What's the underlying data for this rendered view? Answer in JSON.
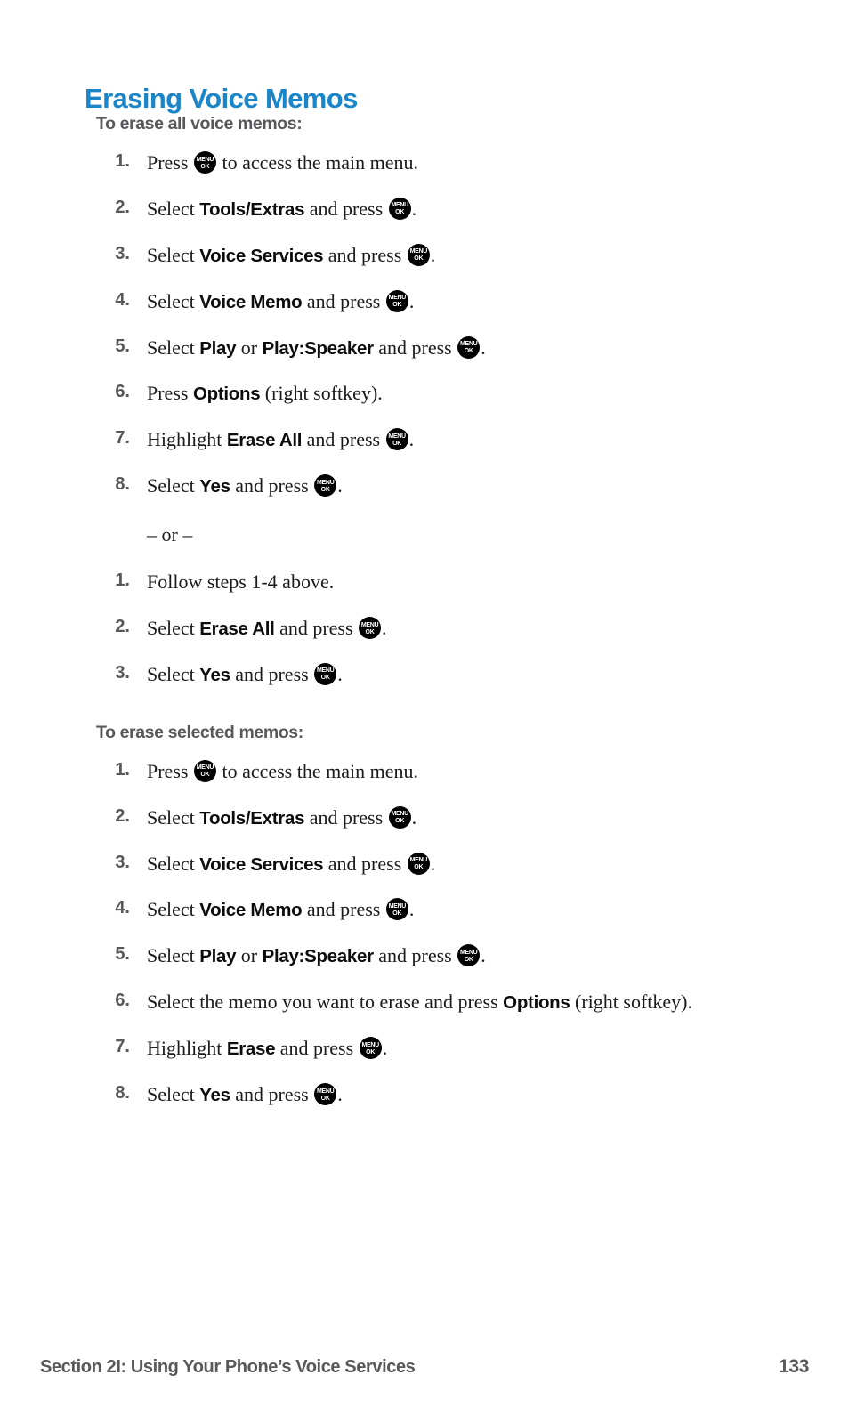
{
  "page": {
    "title": "Erasing Voice Memos",
    "title_color": "#1a86c9",
    "heading_color": "#58585a"
  },
  "menu_key": {
    "line1": "MENU",
    "line2": "OK",
    "name": "menu-ok-key-icon"
  },
  "sections": [
    {
      "heading": "To erase all voice memos:",
      "steps": [
        {
          "num": "1.",
          "pre": "Press ",
          "key": true,
          "post": " to access the main menu."
        },
        {
          "num": "2.",
          "pre": "Select ",
          "bold": "Tools/Extras",
          "mid": " and press ",
          "key": true,
          "post": "."
        },
        {
          "num": "3.",
          "pre": "Select ",
          "bold": "Voice Services",
          "mid": " and press ",
          "key": true,
          "post": "."
        },
        {
          "num": "4.",
          "pre": "Select ",
          "bold": "Voice Memo",
          "mid": " and press ",
          "key": true,
          "post": "."
        },
        {
          "num": "5.",
          "pre": "Select ",
          "bold": "Play",
          "mid2": " or ",
          "bold2": "Play:Speaker",
          "mid": " and press ",
          "key": true,
          "post": "."
        },
        {
          "num": "6.",
          "pre": "Press ",
          "bold": "Options",
          "mid": " (right softkey).",
          "key": false,
          "post": ""
        },
        {
          "num": "7.",
          "pre": "Highlight ",
          "bold": "Erase All",
          "mid": " and press ",
          "key": true,
          "post": "."
        },
        {
          "num": "8.",
          "pre": "Select ",
          "bold": "Yes",
          "mid": " and press ",
          "key": true,
          "post": "."
        }
      ],
      "divider": "– or –",
      "steps_alt": [
        {
          "num": "1.",
          "pre": "Follow steps 1-4 above.",
          "key": false,
          "post": ""
        },
        {
          "num": "2.",
          "pre": "Select ",
          "bold": "Erase All",
          "mid": " and press ",
          "key": true,
          "post": "."
        },
        {
          "num": "3.",
          "pre": "Select ",
          "bold": "Yes",
          "mid": " and press ",
          "key": true,
          "post": "."
        }
      ]
    },
    {
      "heading": "To erase selected memos:",
      "steps": [
        {
          "num": "1.",
          "pre": "Press ",
          "key": true,
          "post": " to access the main menu."
        },
        {
          "num": "2.",
          "pre": "Select ",
          "bold": "Tools/Extras",
          "mid": " and press ",
          "key": true,
          "post": "."
        },
        {
          "num": "3.",
          "pre": "Select ",
          "bold": "Voice Services",
          "mid": " and press ",
          "key": true,
          "post": "."
        },
        {
          "num": "4.",
          "pre": "Select ",
          "bold": "Voice Memo",
          "mid": " and press ",
          "key": true,
          "post": "."
        },
        {
          "num": "5.",
          "pre": "Select ",
          "bold": "Play",
          "mid2": " or ",
          "bold2": "Play:Speaker",
          "mid": " and press ",
          "key": true,
          "post": "."
        },
        {
          "num": "6.",
          "pre": "Select the memo you want to erase and press ",
          "bold": "Options",
          "mid": " (right softkey).",
          "key": false,
          "post": ""
        },
        {
          "num": "7.",
          "pre": "Highlight ",
          "bold": "Erase",
          "mid": " and press ",
          "key": true,
          "post": "."
        },
        {
          "num": "8.",
          "pre": "Select ",
          "bold": "Yes",
          "mid": " and press ",
          "key": true,
          "post": "."
        }
      ]
    }
  ],
  "footer": {
    "section_label": "Section 2I: Using Your Phone’s Voice Services",
    "page_number": "133"
  }
}
